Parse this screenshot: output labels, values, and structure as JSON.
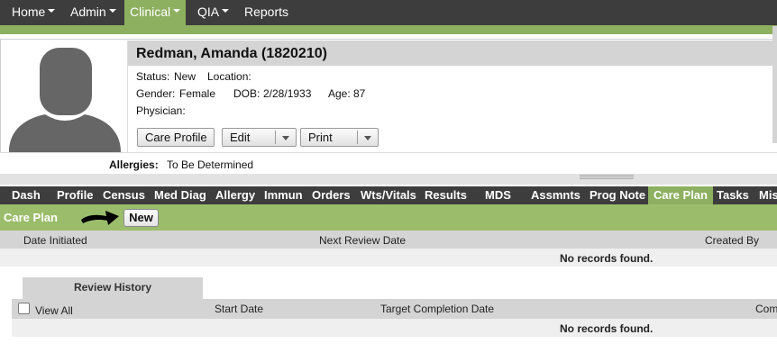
{
  "nav": {
    "items": [
      {
        "label": "Home",
        "dropdown": true
      },
      {
        "label": "Admin",
        "dropdown": true
      },
      {
        "label": "Clinical",
        "dropdown": true,
        "active": true
      },
      {
        "label": "QIA",
        "dropdown": true
      },
      {
        "label": "Reports",
        "dropdown": false
      }
    ]
  },
  "resident": {
    "name": "Redman, Amanda (1820210)",
    "status_label": "Status:",
    "status": "New",
    "location_label": "Location:",
    "location": "",
    "gender_label": "Gender:",
    "gender": "Female",
    "dob_label": "DOB:",
    "dob": "2/28/1933",
    "age_label": "Age:",
    "age": "87",
    "physician_label": "Physician:",
    "physician": "",
    "allergies_label": "Allergies:",
    "allergies": "To Be Determined"
  },
  "actions": {
    "care_profile": "Care Profile",
    "edit": "Edit",
    "print": "Print"
  },
  "tabs": [
    {
      "label": "Dash"
    },
    {
      "label": "Profile"
    },
    {
      "label": "Census"
    },
    {
      "label": "Med Diag"
    },
    {
      "label": "Allergy"
    },
    {
      "label": "Immun"
    },
    {
      "label": "Orders"
    },
    {
      "label": "Wts/Vitals"
    },
    {
      "label": "Results"
    },
    {
      "label": "MDS"
    },
    {
      "label": "Assmnts"
    },
    {
      "label": "Prog Note"
    },
    {
      "label": "Care Plan",
      "active": true
    },
    {
      "label": "Tasks"
    },
    {
      "label": "Mis"
    }
  ],
  "care_plan": {
    "title": "Care Plan",
    "new_button": "New",
    "columns": [
      "Date Initiated",
      "Next Review Date",
      "Created By"
    ],
    "empty_message": "No records found."
  },
  "review_history": {
    "tab_label": "Review History",
    "view_all": "View All",
    "columns": [
      "Start Date",
      "Target Completion Date",
      "Com"
    ],
    "empty_message": "No records found."
  },
  "colors": {
    "nav_bg": "#3d3d3d",
    "accent_green": "#8db060",
    "header_green": "#9bbd6b",
    "table_header": "#d4d4d4"
  }
}
